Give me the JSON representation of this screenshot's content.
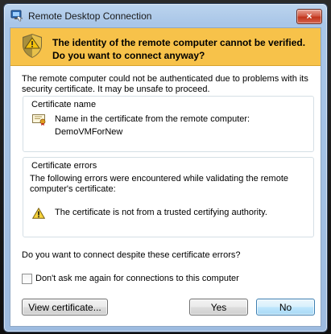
{
  "window": {
    "title": "Remote Desktop Connection",
    "close_label": "×"
  },
  "banner": {
    "icon": "shield-warning-icon",
    "message": "The identity of the remote computer cannot be verified. Do you want to connect anyway?",
    "color": "#f7c24a"
  },
  "intro": "The remote computer could not be authenticated due to problems with its security certificate. It may be unsafe to proceed.",
  "certificate": {
    "group_title": "Certificate name",
    "icon": "certificate-icon",
    "label": "Name in the certificate from the remote computer:",
    "value": "DemoVMForNew"
  },
  "errors": {
    "group_title": "Certificate errors",
    "intro": "The following errors were encountered while validating the remote computer's certificate:",
    "icon": "warning-icon",
    "items": [
      "The certificate is not from a trusted certifying authority."
    ]
  },
  "question": "Do you want to connect despite these certificate errors?",
  "checkbox": {
    "label": "Don't ask me again for connections to this computer",
    "checked": false
  },
  "buttons": {
    "view_certificate": "View certificate...",
    "yes": "Yes",
    "no": "No"
  }
}
